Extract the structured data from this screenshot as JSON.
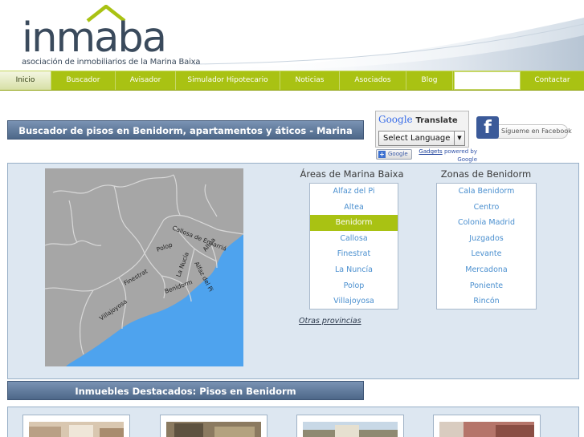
{
  "logo": {
    "word": "inmaba",
    "tagline": "asociación de inmobiliarios de la Marina Baixa",
    "brand_green": "#a9c213",
    "logo_color": "#3a4a5c"
  },
  "nav": {
    "items": [
      {
        "label": "Inicio",
        "active": true
      },
      {
        "label": "Buscador"
      },
      {
        "label": "Avisador"
      },
      {
        "label": "Simulador Hipotecario"
      },
      {
        "label": "Noticias"
      },
      {
        "label": "Asociados"
      },
      {
        "label": "Blog"
      },
      {
        "label": ""
      },
      {
        "label": "Contactar"
      }
    ]
  },
  "search_header": "Buscador de pisos en Benidorm, apartamentos y áticos - Marina Baixa",
  "translate": {
    "google": "Google",
    "translate": "Translate",
    "select_label": "Select Language",
    "button": "Google",
    "gadgets_link": "Gadgets",
    "powered_by": "powered by",
    "powered_google": "Google"
  },
  "facebook": {
    "icon": "f",
    "label": "Sígueme en Facebook"
  },
  "map": {
    "labels": [
      "Callosa de Ensarriá",
      "Altea",
      "Polop",
      "La Nucía",
      "Alfaz del Pi",
      "Finestrat",
      "Benidorm",
      "Villajoyosa"
    ],
    "sea_color": "#4ea3ee",
    "land_color": "#a6a6a6"
  },
  "areas": {
    "title": "Áreas de Marina Baixa",
    "items": [
      "Alfaz del Pi",
      "Altea",
      "Benidorm",
      "Callosa",
      "Finestrat",
      "La Nuncía",
      "Polop",
      "Villajoyosa"
    ],
    "selected": "Benidorm"
  },
  "zonas": {
    "title": "Zonas de Benidorm",
    "items": [
      "Cala Benidorm",
      "Centro",
      "Colonia Madrid",
      "Juzgados",
      "Levante",
      "Mercadona",
      "Poniente",
      "Rincón"
    ]
  },
  "otras": "Otras provincias",
  "featured_header": "Inmuebles Destacados: Pisos en Benidorm"
}
